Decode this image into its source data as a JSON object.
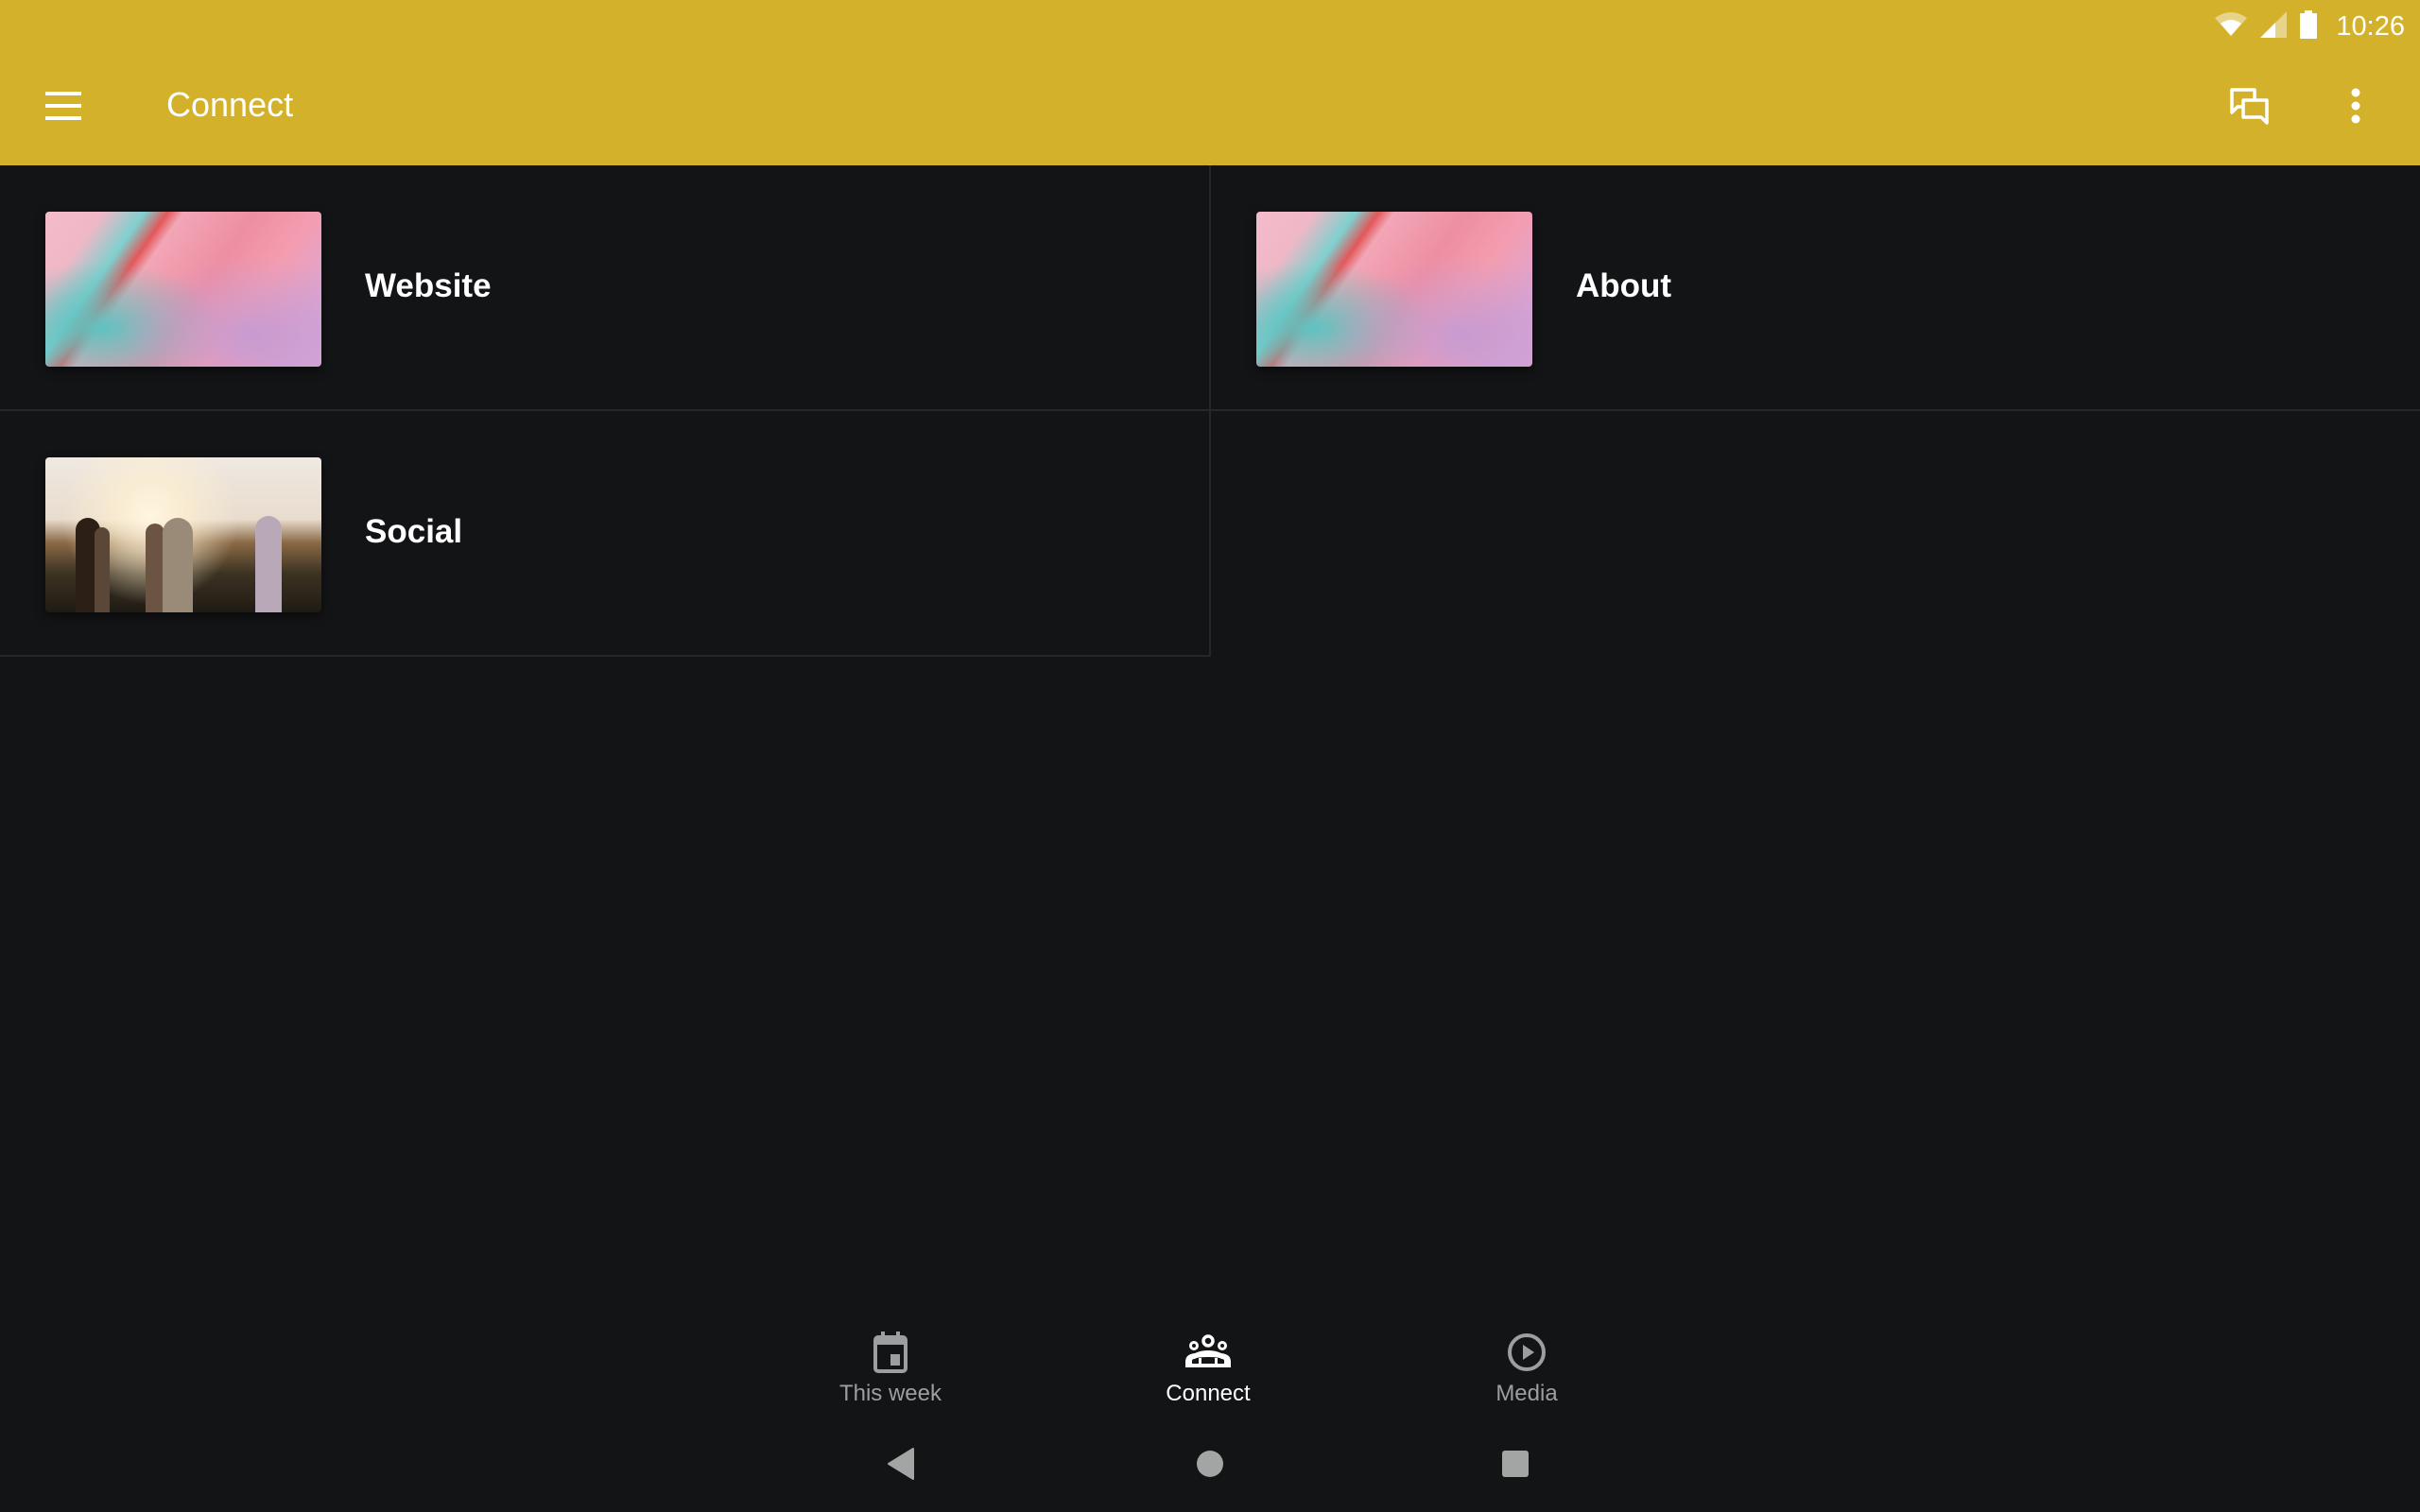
{
  "status_bar": {
    "time": "10:26"
  },
  "app_bar": {
    "title": "Connect",
    "accent_color": "#d4b12a"
  },
  "tiles": [
    {
      "label": "Website",
      "image": "pastel-marble"
    },
    {
      "label": "About",
      "image": "pastel-marble"
    },
    {
      "label": "Social",
      "image": "friends-sunset"
    }
  ],
  "bottom_nav": {
    "items": [
      {
        "label": "This week",
        "icon": "calendar-icon",
        "active": false
      },
      {
        "label": "Connect",
        "icon": "groups-icon",
        "active": true
      },
      {
        "label": "Media",
        "icon": "play-circle-icon",
        "active": false
      }
    ]
  }
}
